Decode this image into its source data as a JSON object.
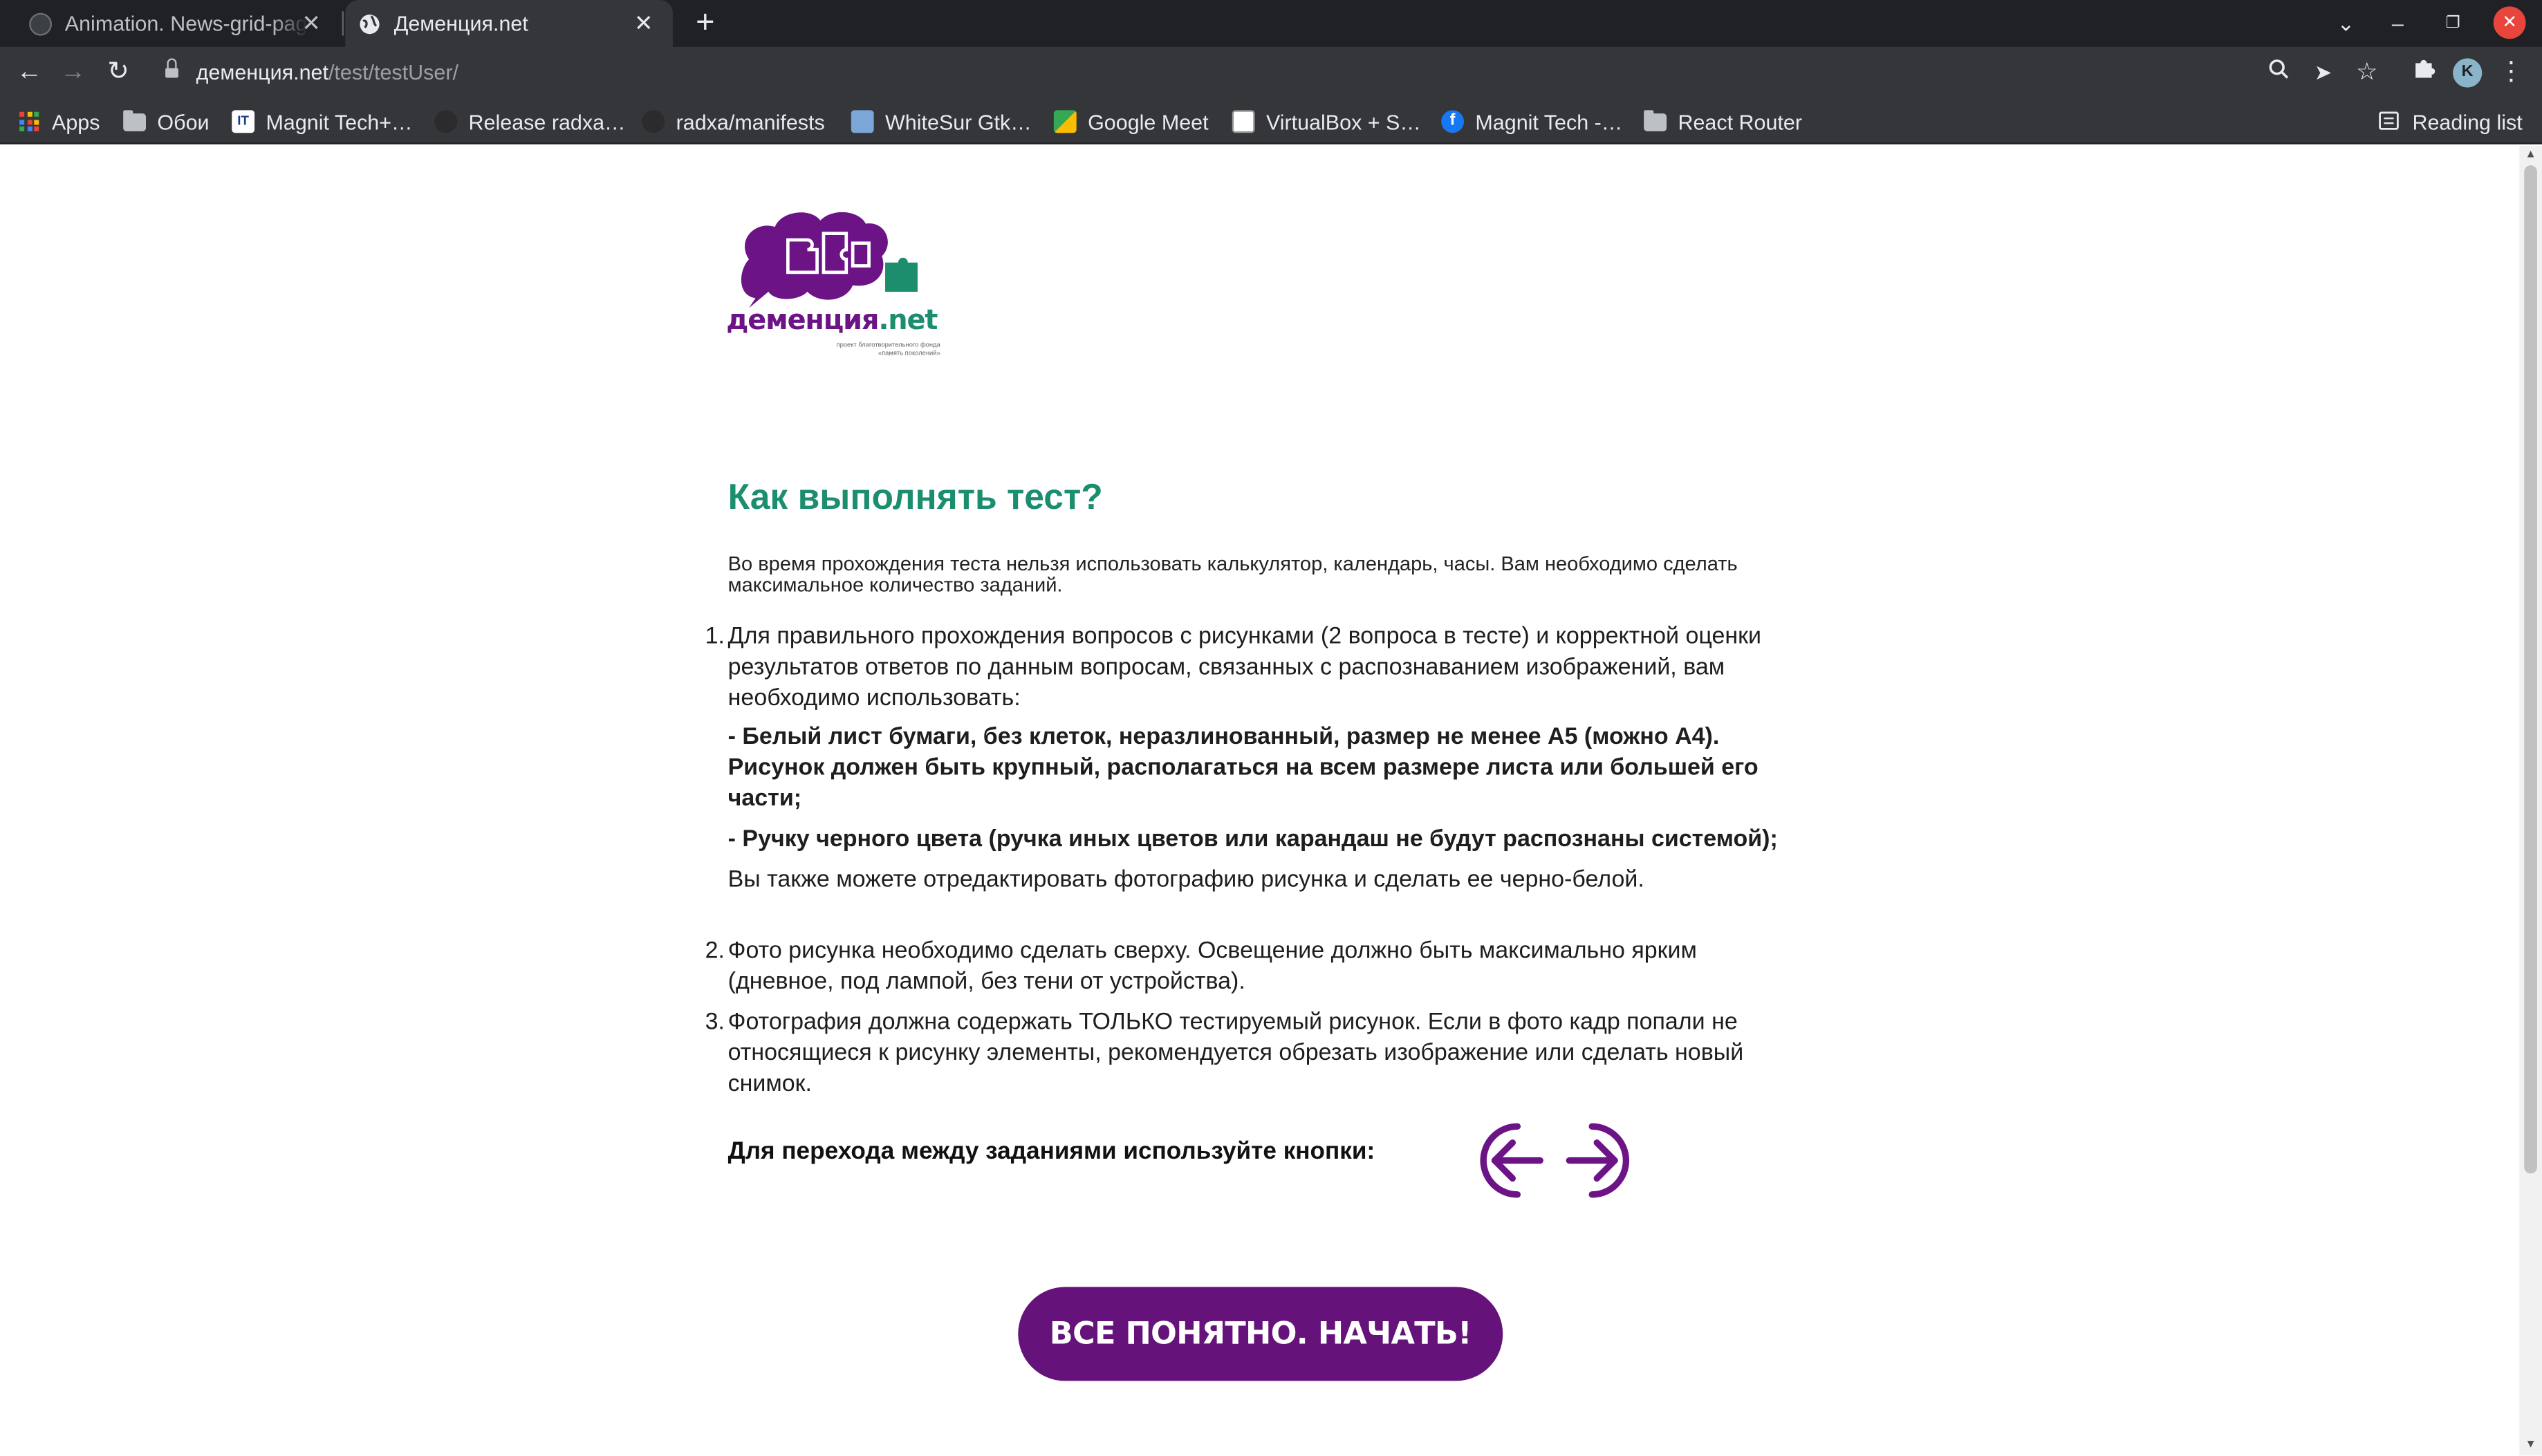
{
  "browser": {
    "tabs": [
      {
        "title": "Animation. News-grid-page",
        "favicon": "github-icon"
      },
      {
        "title": "Деменция.net",
        "favicon": "globe-icon"
      }
    ],
    "url_host": "деменция.net",
    "url_path": "/test/testUser/",
    "profile_initial": "K",
    "bookmarks": [
      {
        "label": "Apps",
        "icon": "apps-grid-icon"
      },
      {
        "label": "Обои",
        "icon": "folder-icon"
      },
      {
        "label": "Magnit Tech+…",
        "icon": "it-icon"
      },
      {
        "label": "Release radxa…",
        "icon": "github-icon"
      },
      {
        "label": "radxa/manifests",
        "icon": "github-icon"
      },
      {
        "label": "WhiteSur Gtk…",
        "icon": "whitesur-icon"
      },
      {
        "label": "Google Meet",
        "icon": "meet-icon"
      },
      {
        "label": "VirtualBox + S…",
        "icon": "virtualbox-icon"
      },
      {
        "label": "Magnit Tech -…",
        "icon": "facebook-icon"
      },
      {
        "label": "React Router",
        "icon": "folder-icon"
      }
    ],
    "reading_list": "Reading list"
  },
  "logo": {
    "wordmark_main": "деменция",
    "wordmark_tld": ".net",
    "subtitle": "проект благотворительного фонда «память поколений»"
  },
  "content": {
    "heading": "Как выполнять тест?",
    "intro": "Во время прохождения теста нельзя использовать калькулятор, календарь, часы. Вам необходимо сделать максимальное количество заданий.",
    "items": [
      {
        "num": "1.",
        "text": "Для правильного прохождения вопросов с рисунками (2 вопроса в тесте) и корректной оценки результатов ответов по данным вопросам, связанных с распознаванием изображений, вам необходимо использовать:",
        "bold_1": "- Белый лист бумаги, без клеток, неразлинованный, размер не менее А5 (можно А4). Рисунок должен быть крупный, располагаться на всем размере листа или большей его части;",
        "bold_2": "- Ручку черного цвета (ручка иных цветов или карандаш не будут распознаны системой);",
        "note": "Вы также можете отредактировать фотографию рисунка и сделать ее черно-белой."
      },
      {
        "num": "2.",
        "text": "Фото рисунка необходимо сделать сверху. Освещение должно быть максимально ярким (дневное, под лампой, без тени от устройства)."
      },
      {
        "num": "3.",
        "text": "Фотография должна содержать ТОЛЬКО тестируемый рисунок. Если в фото кадр попали не относящиеся к рисунку элементы, рекомендуется обрезать изображение или сделать новый снимок."
      }
    ],
    "nav_hint": "Для перехода между заданиями используйте кнопки:",
    "start_button": "ВСЕ ПОНЯТНО. НАЧАТЬ!"
  },
  "colors": {
    "brand_purple": "#65137a",
    "brand_green": "#1b8e6f"
  }
}
